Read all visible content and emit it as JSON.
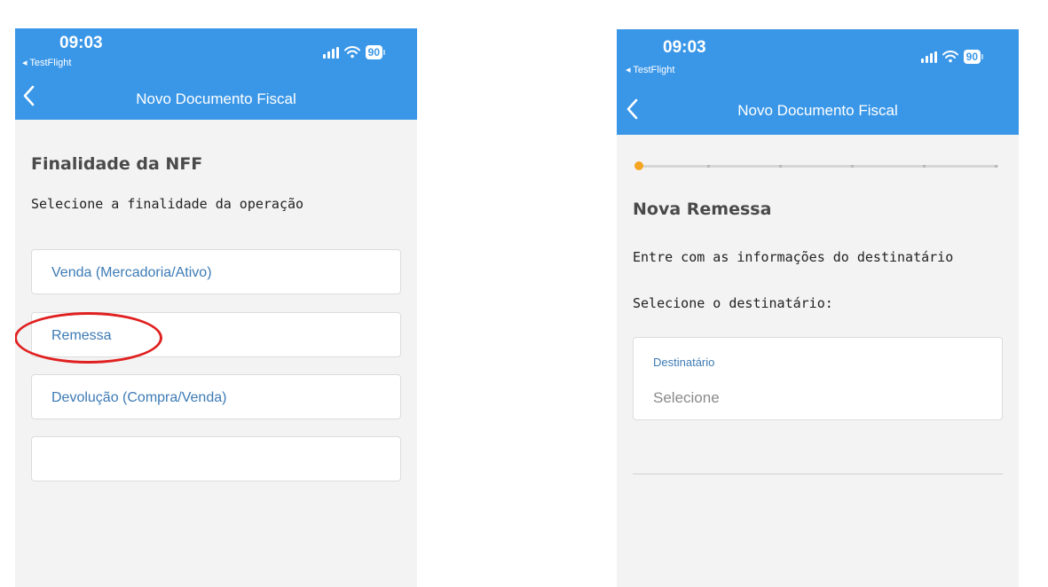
{
  "left_screen": {
    "status_bar": {
      "time": "09:03",
      "back_app": "◂ TestFlight",
      "battery": "90"
    },
    "nav": {
      "title": "Novo Documento Fiscal"
    },
    "heading": "Finalidade da NFF",
    "subtitle": "Selecione a finalidade da operação",
    "options": [
      {
        "label": "Venda (Mercadoria/Ativo)"
      },
      {
        "label": "Remessa"
      },
      {
        "label": "Devolução (Compra/Venda)"
      },
      {
        "label": ""
      }
    ]
  },
  "right_screen": {
    "status_bar": {
      "time": "09:03",
      "back_app": "◂ TestFlight",
      "battery": "90"
    },
    "nav": {
      "title": "Novo Documento Fiscal"
    },
    "progress": {
      "current_step": 1,
      "total_steps": 6
    },
    "heading": "Nova Remessa",
    "subtitle": "Entre com as informações do destinatário",
    "prompt": "Selecione o destinatário:",
    "field": {
      "label": "Destinatário",
      "placeholder": "Selecione"
    }
  },
  "colors": {
    "header_blue": "#3a97e8",
    "option_text_blue": "#3d7bb5",
    "highlight_red": "#e02020",
    "progress_orange": "#f4a622",
    "screen_background": "#f3f3f3"
  },
  "icons": [
    "signal-icon",
    "wifi-icon",
    "battery-icon",
    "chevron-left-icon"
  ]
}
